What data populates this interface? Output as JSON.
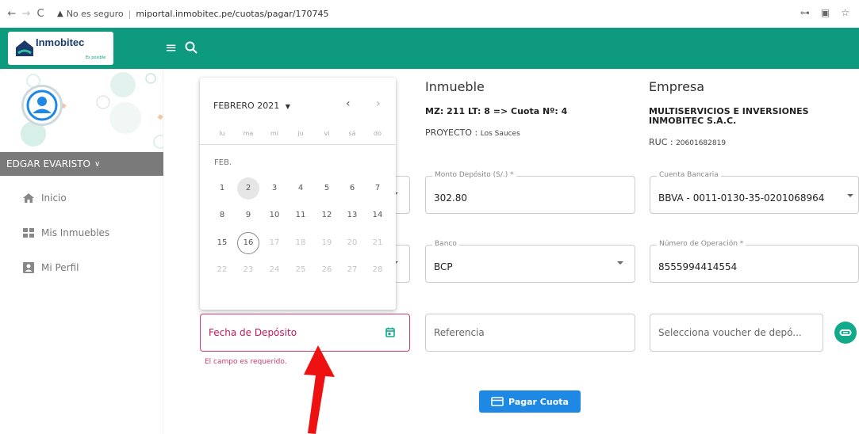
{
  "browser": {
    "security_label": "No es seguro",
    "url": "miportal.inmobitec.pe/cuotas/pagar/170745"
  },
  "app": {
    "logo_name": "Inmobitec",
    "logo_tagline": "Es posible",
    "brand_color": "#0d9a7e"
  },
  "sidebar": {
    "user_name": "EDGAR EVARISTO",
    "items": [
      {
        "label": "Inicio",
        "icon": "home-icon"
      },
      {
        "label": "Mis Inmuebles",
        "icon": "grid-icon"
      },
      {
        "label": "Mi Perfil",
        "icon": "profile-icon"
      }
    ]
  },
  "inmueble": {
    "title": "Inmueble",
    "lote": "MZ: 211 LT: 8 => Cuota Nº: 4",
    "proyecto_label": "PROYECTO :",
    "proyecto_value": "Los Sauces"
  },
  "empresa": {
    "title": "Empresa",
    "name_line1": "MULTISERVICIOS E INVERSIONES",
    "name_line2": "INMOBITEC S.A.C.",
    "ruc_label": "RUC :",
    "ruc_value": "20601682819"
  },
  "form": {
    "monto": {
      "label": "Monto Depósito (S/.) *",
      "value": "302.80"
    },
    "cuenta": {
      "label": "Cuenta Bancaria",
      "value": "BBVA - 0011-0130-35-0201068964"
    },
    "banco": {
      "label": "Banco",
      "value": "BCP"
    },
    "operacion": {
      "label": "Número de Operación *",
      "value": "8555994414554"
    },
    "fecha": {
      "placeholder": "Fecha de Depósito",
      "error": "El campo es requerido."
    },
    "referencia": {
      "placeholder": "Referencia"
    },
    "voucher": {
      "placeholder": "Selecciona voucher de depó..."
    },
    "submit_label": "Pagar Cuota",
    "error_color": "#d23a6b"
  },
  "datepicker": {
    "header": "FEBRERO 2021",
    "month_short": "FEB.",
    "weekdays": [
      "lu",
      "ma",
      "mi",
      "ju",
      "vi",
      "sá",
      "do"
    ],
    "weeks": [
      [
        "1",
        "2",
        "3",
        "4",
        "5",
        "6",
        "7"
      ],
      [
        "8",
        "9",
        "10",
        "11",
        "12",
        "13",
        "14"
      ],
      [
        "15",
        "16",
        "17",
        "18",
        "19",
        "20",
        "21"
      ],
      [
        "22",
        "23",
        "24",
        "25",
        "26",
        "27",
        "28"
      ]
    ],
    "selected_day": "2",
    "today_day": "16"
  }
}
